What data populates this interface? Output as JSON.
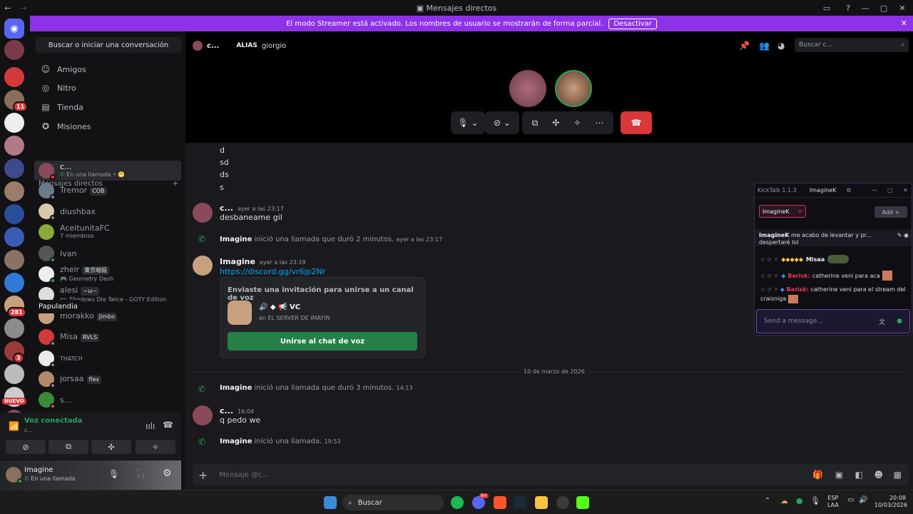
{
  "window": {
    "title": "Mensajes directos"
  },
  "streamer_banner": {
    "text": "El modo Streamer está activado. Los nombres de usuario se mostrarán de forma parcial.",
    "button": "Desactivar"
  },
  "sidebar": {
    "search": "Buscar o iniciar una conversación",
    "nav": [
      {
        "label": "Amigos",
        "icon": "friends-icon"
      },
      {
        "label": "Nitro",
        "icon": "nitro-icon"
      },
      {
        "label": "Tienda",
        "icon": "shop-icon"
      },
      {
        "label": "Misiones",
        "icon": "quests-icon"
      }
    ],
    "dm_header": "Mensajes directos",
    "dms": [
      {
        "name": "c...",
        "sub": "En una llamada • ",
        "tag": ""
      },
      {
        "name": "Tremor",
        "sub": "",
        "tag": "COB"
      },
      {
        "name": "diushbax",
        "sub": "",
        "tag": ""
      },
      {
        "name": "AceitunitaFC",
        "sub": "7 miembros",
        "tag": ""
      },
      {
        "name": "Ivan",
        "sub": "",
        "tag": ""
      },
      {
        "name": "zheir",
        "sub": "Geometry Dash",
        "tag": "東京暗殺"
      },
      {
        "name": "alesi",
        "sub": "ro: Shadows Die Twice - GOTY Edition",
        "tag": "~ω~"
      },
      {
        "name": "morakko",
        "sub": "",
        "tag": "Jimbo"
      },
      {
        "name": "Misa",
        "sub": "",
        "tag": "RVLS"
      },
      {
        "name": "THATCH",
        "sub": "",
        "tag": ""
      },
      {
        "name": "jorsaa",
        "sub": "",
        "tag": "flex"
      },
      {
        "name": "s...",
        "sub": "",
        "tag": ""
      }
    ],
    "tooltip": "Papulandia",
    "voice": {
      "status": "Voz conectada",
      "channel": "c..."
    },
    "user": {
      "name": "Imagine",
      "status": "En una llamada"
    }
  },
  "rail": {
    "badges": [
      "11",
      "281",
      "3"
    ],
    "new_label": "NUEVO"
  },
  "topbar": {
    "name": "c...",
    "alias_label": "ALIAS",
    "alias": "giorgio",
    "search_placeholder": "Buscar c..."
  },
  "chat": {
    "lines": [
      "d",
      "sd",
      "ds",
      "s"
    ],
    "messages": [
      {
        "author": "c...",
        "time": "ayer a las 23:17",
        "text": "desbaneame gil"
      },
      {
        "author": "Imagine",
        "time": "ayer a las 23:19",
        "text": "https://discord.gg/vr6jp2Nr"
      }
    ],
    "sys1": {
      "author": "Imagine",
      "text": "inició una llamada que duró 2 minutos.",
      "time": "ayer a las 23:17"
    },
    "invite": {
      "title": "Enviaste una invitación para unirse a un canal de voz",
      "channel": "VC",
      "server": "en EL SERVER DE IMAYIN",
      "button": "Unirse al chat de voz"
    },
    "divider": "10 de marzo de 2026",
    "sys2": {
      "author": "Imagine",
      "text": "inició una llamada que duró 3 minutos.",
      "time": "14:13"
    },
    "msg3": {
      "author": "c...",
      "time": "16:04",
      "text": "q pedo we"
    },
    "sys3": {
      "author": "Imagine",
      "text": "inició una llamada.",
      "time": "19:53"
    },
    "input_placeholder": "Mensaje @c..."
  },
  "kicktalk": {
    "title": "KickTalk 1.1.3",
    "tab": "ImagineK",
    "chip": "ImagineK",
    "add": "Add",
    "pinned_user": "ImagineK",
    "pinned_text": "me acabo de levantar y pr...",
    "pinned_tail": "despertaré lol",
    "lines": [
      {
        "user": "Misaa",
        "text": ""
      },
      {
        "user": "Barisk:",
        "text": "catherine veni para aca"
      },
      {
        "user": "Barisk:",
        "text": "catherine veni para el stream del craisniga"
      }
    ],
    "input_placeholder": "Send a message..."
  },
  "taskbar": {
    "search": "Buscar",
    "lang": "ESP",
    "lang2": "LAA",
    "time": "20:08",
    "date": "10/03/2026",
    "discord_badge": "9+"
  }
}
